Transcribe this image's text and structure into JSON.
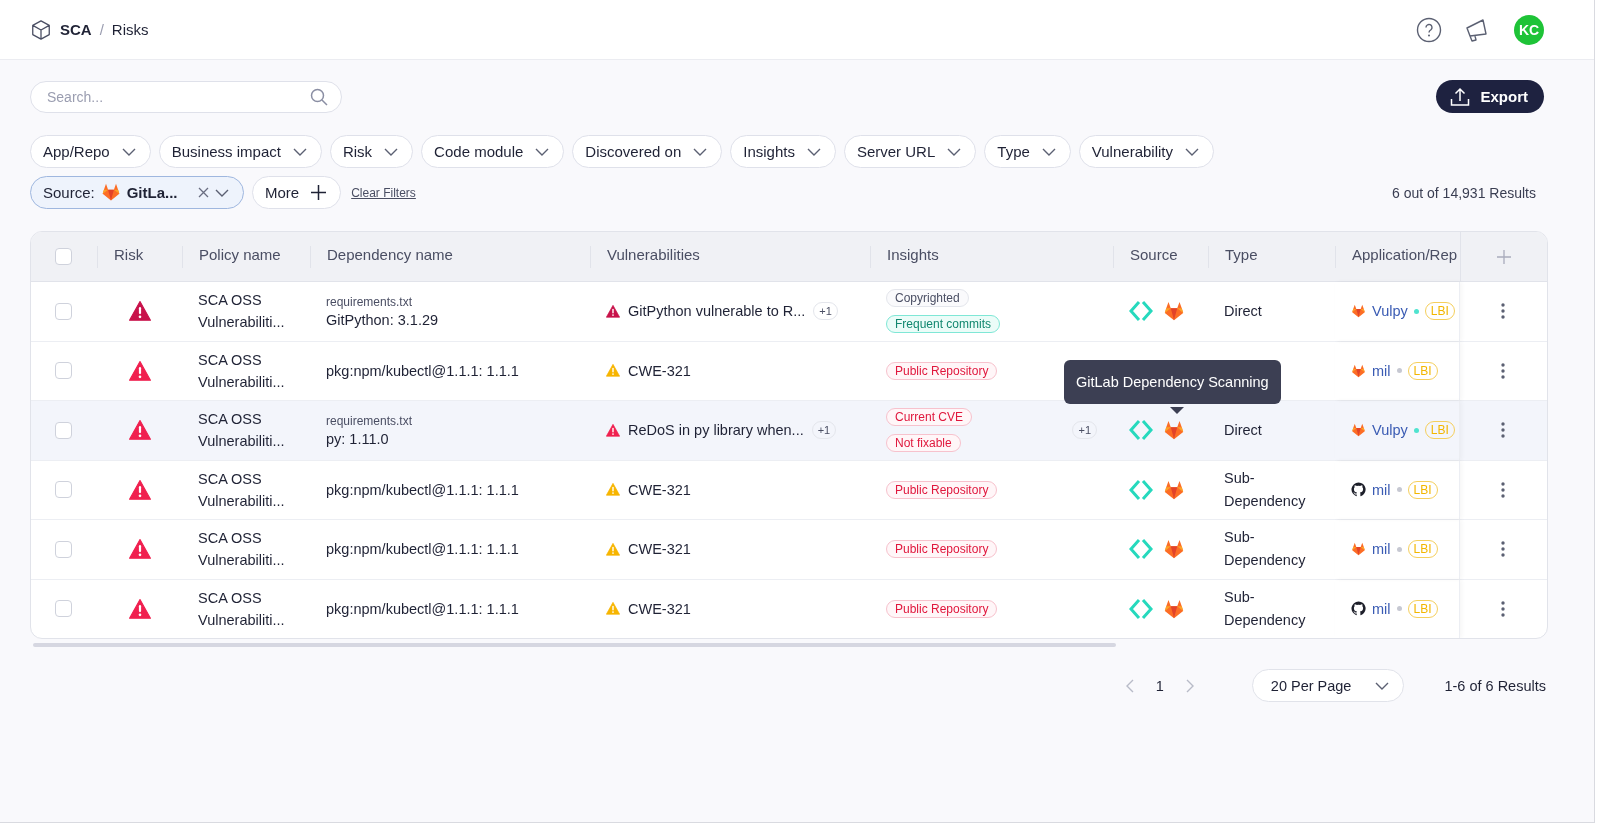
{
  "breadcrumb": [
    {
      "label": "SCA"
    },
    {
      "label": "Risks"
    }
  ],
  "breadcrumb_separator": "/",
  "header": {
    "avatar": "KC"
  },
  "search": {
    "placeholder": "Search..."
  },
  "export_button": "Export",
  "filters": [
    "App/Repo",
    "Business impact",
    "Risk",
    "Code module",
    "Discovered on",
    "Insights",
    "Server URL",
    "Type",
    "Vulnerability"
  ],
  "active_filter": {
    "label": "Source:",
    "value": "GitLa..."
  },
  "more_button": "More",
  "clear_filters": "Clear Filters",
  "results_summary": "6 out of 14,931 Results",
  "table": {
    "header_selected": false,
    "columns": [
      "Risk",
      "Policy name",
      "Dependency name",
      "Vulnerabilities",
      "Insights",
      "Source",
      "Type",
      "Application/Rep"
    ],
    "rows": [
      {
        "selected": false,
        "highlighted": false,
        "risk": {
          "color": "#c8124a"
        },
        "policy": "SCA OSS Vulnerabiliti...",
        "file": "requirements.txt",
        "dependency": "GitPython: 3.1.29",
        "vulnerability": {
          "color": "#c8124a",
          "text": "GitPython vulnerable to R...",
          "more": "+1"
        },
        "insights": [
          {
            "label": "Copyrighted",
            "kind": "neutral"
          },
          {
            "label": "Frequent commits",
            "kind": "positive"
          }
        ],
        "sources": [
          {
            "kind": "scanner"
          },
          {
            "kind": "gitlab"
          }
        ],
        "type": "Direct",
        "app": {
          "kind": "gitlab",
          "name": "Vulpy",
          "color": "#4fe3cf",
          "tag": "LBI"
        }
      },
      {
        "selected": false,
        "highlighted": false,
        "risk": {
          "color": "#f0204f"
        },
        "policy": "SCA OSS Vulnerabiliti...",
        "dependency": "pkg:npm/kubectl@1.1.1: 1.1.1",
        "vulnerability": {
          "color": "#f7b500",
          "text": "CWE-321"
        },
        "insights": [
          {
            "label": "Public Repository",
            "kind": "negative"
          }
        ],
        "app": {
          "kind": "gitlab",
          "name": "mil",
          "color": "#c6c8d2",
          "tag": "LBI"
        }
      },
      {
        "selected": false,
        "highlighted": true,
        "risk": {
          "color": "#f0204f"
        },
        "policy": "SCA OSS Vulnerabiliti...",
        "file": "requirements.txt",
        "dependency": "py: 1.11.0",
        "vulnerability": {
          "color": "#f0204f",
          "text": "ReDoS in py library when...",
          "more": "+1"
        },
        "insights": [
          {
            "label": "Current CVE",
            "kind": "negative"
          },
          {
            "label": "Not fixable",
            "kind": "negative"
          }
        ],
        "insights_more": "+1",
        "sources": [
          {
            "kind": "scanner"
          },
          {
            "kind": "gitlab"
          }
        ],
        "type": "Direct",
        "app": {
          "kind": "gitlab",
          "name": "Vulpy",
          "color": "#4fe3cf",
          "tag": "LBI"
        }
      },
      {
        "selected": false,
        "highlighted": false,
        "risk": {
          "color": "#f0204f"
        },
        "policy": "SCA OSS Vulnerabiliti...",
        "dependency": "pkg:npm/kubectl@1.1.1: 1.1.1",
        "vulnerability": {
          "color": "#f7b500",
          "text": "CWE-321"
        },
        "insights": [
          {
            "label": "Public Repository",
            "kind": "negative"
          }
        ],
        "sources": [
          {
            "kind": "scanner"
          },
          {
            "kind": "gitlab"
          }
        ],
        "type": "Sub-Dependency",
        "app": {
          "kind": "github",
          "name": "mil",
          "color": "#c6c8d2",
          "tag": "LBI"
        }
      },
      {
        "selected": false,
        "highlighted": false,
        "risk": {
          "color": "#f0204f"
        },
        "policy": "SCA OSS Vulnerabiliti...",
        "dependency": "pkg:npm/kubectl@1.1.1: 1.1.1",
        "vulnerability": {
          "color": "#f7b500",
          "text": "CWE-321"
        },
        "insights": [
          {
            "label": "Public Repository",
            "kind": "negative"
          }
        ],
        "sources": [
          {
            "kind": "scanner"
          },
          {
            "kind": "gitlab"
          }
        ],
        "type": "Sub-Dependency",
        "app": {
          "kind": "gitlab",
          "name": "mil",
          "color": "#c6c8d2",
          "tag": "LBI"
        }
      },
      {
        "selected": false,
        "highlighted": false,
        "risk": {
          "color": "#f0204f"
        },
        "policy": "SCA OSS Vulnerabiliti...",
        "dependency": "pkg:npm/kubectl@1.1.1: 1.1.1",
        "vulnerability": {
          "color": "#f7b500",
          "text": "CWE-321"
        },
        "insights": [
          {
            "label": "Public Repository",
            "kind": "negative"
          }
        ],
        "sources": [
          {
            "kind": "scanner"
          },
          {
            "kind": "gitlab"
          }
        ],
        "type": "Sub-Dependency",
        "app": {
          "kind": "github",
          "name": "mil",
          "color": "#c6c8d2",
          "tag": "LBI"
        }
      }
    ]
  },
  "tooltip": "GitLab Dependency Scanning",
  "pagination": {
    "page": "1",
    "per_page": "20 Per Page",
    "range": "1-6 of 6 Results"
  }
}
